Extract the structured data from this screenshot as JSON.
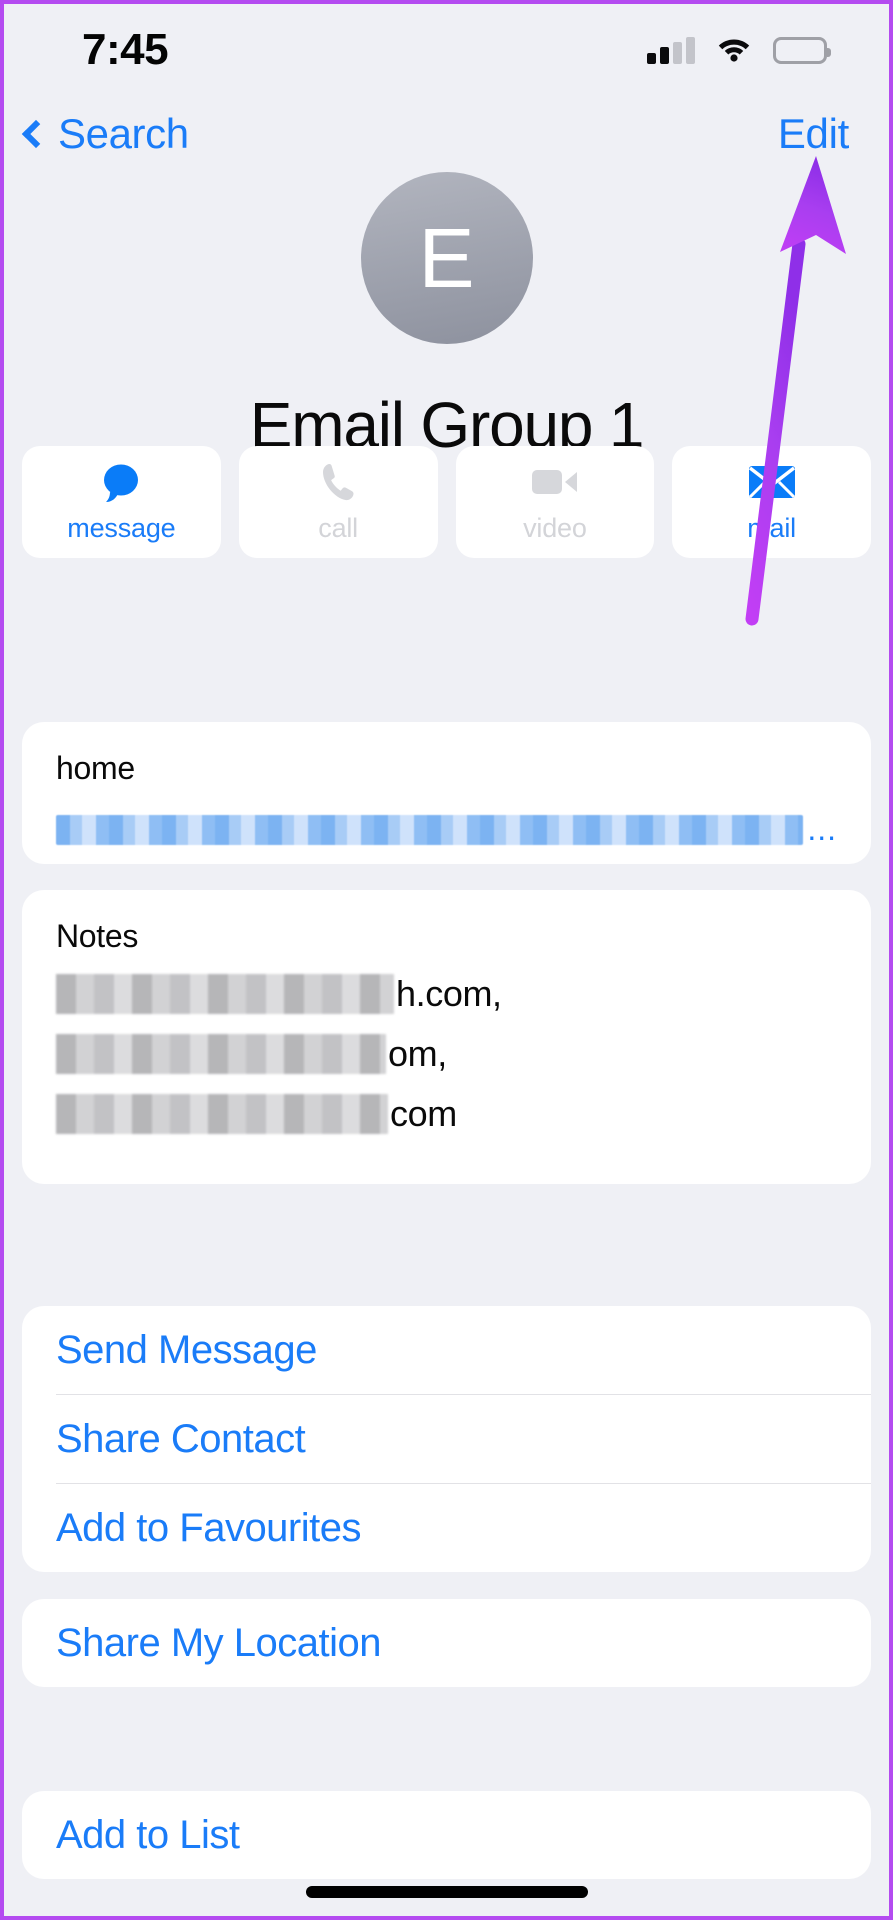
{
  "status_bar": {
    "time": "7:45",
    "signal_icon": "cellular-signal-icon",
    "wifi_icon": "wifi-icon",
    "battery_icon": "battery-icon"
  },
  "nav": {
    "back_label": "Search",
    "back_icon": "chevron-left-icon",
    "edit_label": "Edit"
  },
  "header": {
    "avatar_initial": "E",
    "contact_name": "Email Group 1"
  },
  "quick_actions": [
    {
      "label": "message",
      "icon": "message-bubble-icon",
      "enabled": true
    },
    {
      "label": "call",
      "icon": "phone-icon",
      "enabled": false
    },
    {
      "label": "video",
      "icon": "video-camera-icon",
      "enabled": false
    },
    {
      "label": "mail",
      "icon": "envelope-icon",
      "enabled": true
    }
  ],
  "email_card": {
    "label": "home",
    "value_redacted": true,
    "ellipsis": "..."
  },
  "notes_card": {
    "label": "Notes",
    "lines": [
      {
        "redacted": true,
        "tail": "h.com,"
      },
      {
        "redacted": true,
        "tail": "om,"
      },
      {
        "redacted": true,
        "tail": "com"
      }
    ]
  },
  "link_groups": [
    {
      "items": [
        "Send Message",
        "Share Contact",
        "Add to Favourites"
      ]
    },
    {
      "items": [
        "Share My Location"
      ]
    },
    {
      "items": [
        "Add to List"
      ]
    }
  ],
  "annotation": {
    "type": "arrow",
    "points_to": "Edit",
    "color": "#a93ef0"
  },
  "colors": {
    "accent_blue": "#1a7cf8",
    "background": "#eff0f5",
    "card": "#ffffff",
    "disabled_gray": "#d3d4d8",
    "annotation_purple": "#a93ef0",
    "frame_purple": "#b44bf0"
  }
}
